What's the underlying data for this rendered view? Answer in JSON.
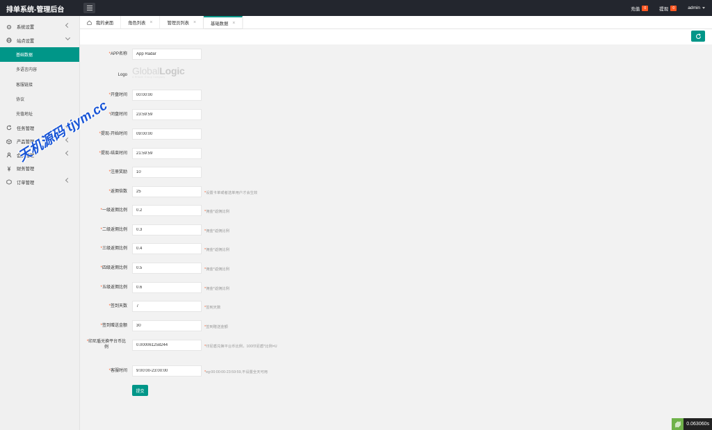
{
  "app": {
    "title": "排单系统-管理后台"
  },
  "topbar": {
    "recharge_label": "充值",
    "recharge_badge": "0",
    "withdraw_label": "提现",
    "withdraw_badge": "0",
    "user_label": "admin"
  },
  "sidebar": {
    "items": [
      {
        "label": "系统设置",
        "icon": "gear-icon"
      },
      {
        "label": "站点设置",
        "icon": "globe-icon",
        "expanded": true
      },
      {
        "label": "任务管理",
        "icon": "refresh-icon"
      },
      {
        "label": "产品管理",
        "icon": "box-icon"
      },
      {
        "label": "会员管理",
        "icon": "user-icon"
      },
      {
        "label": "财务管理",
        "icon": "money-icon"
      },
      {
        "label": "订单管理",
        "icon": "order-icon"
      }
    ],
    "subitems": [
      "基础数据",
      "多语言内容",
      "客服链接",
      "协议",
      "充值地址"
    ],
    "active_subitem": "基础数据"
  },
  "tabs": [
    {
      "label": "我的桌面",
      "closable": false
    },
    {
      "label": "角色列表",
      "closable": true
    },
    {
      "label": "管理员列表",
      "closable": true
    },
    {
      "label": "基础数据",
      "closable": true,
      "active": true
    }
  ],
  "form": {
    "fields": [
      {
        "label": "APP名称",
        "value": "App Radar",
        "hint": ""
      },
      {
        "label": "Logo",
        "type": "logo"
      },
      {
        "label": "开盘时间",
        "value": "00:00:00",
        "hint": ""
      },
      {
        "label": "闭盘时间",
        "value": "23:59:59",
        "hint": ""
      },
      {
        "label": "提现-开始时间",
        "value": "09:00:00",
        "hint": ""
      },
      {
        "label": "提现-结束时间",
        "value": "21:59:59",
        "hint": ""
      },
      {
        "label": "注册奖励",
        "value": "10",
        "hint": ""
      },
      {
        "label": "返佣倍数",
        "value": "25",
        "hint": "设置卡单或者选单用户才会生效"
      },
      {
        "label": "一级返佣比例",
        "value": "0.2",
        "hint": "佣金*返佣比例"
      },
      {
        "label": "二级返佣比例",
        "value": "0.3",
        "hint": "佣金*返佣比例"
      },
      {
        "label": "三级返佣比例",
        "value": "0.4",
        "hint": "佣金*返佣比例"
      },
      {
        "label": "四级返佣比例",
        "value": "0.5",
        "hint": "佣金*返佣比例"
      },
      {
        "label": "五级返佣比例",
        "value": "0.6",
        "hint": "佣金*返佣比例"
      },
      {
        "label": "签到天数",
        "value": "7",
        "hint": "签到天数"
      },
      {
        "label": "签到赠送金额",
        "value": "30",
        "hint": "签到赠送金额"
      },
      {
        "label": "印尼盾兑换平台币比例",
        "value": "0.000061258244",
        "hint": "印尼盾兑换平台币比例，100印尼盾*比例=U"
      },
      {
        "label": "客服时间",
        "value": "9:00:00-23:00:00",
        "hint": "eg:00:00:00-23:59:59,不设置全天可用"
      }
    ],
    "submit_label": "提交"
  },
  "logo": {
    "main_light": "Global",
    "main_bold": "Logic",
    "sub": "A Hitachi Group Company"
  },
  "watermark": "天机源码 tjym.cc",
  "timer": "0.063060s",
  "colors": {
    "accent": "#009688",
    "topbar": "#23262e",
    "badge": "#ff5722",
    "watermark": "#1a56d6"
  }
}
